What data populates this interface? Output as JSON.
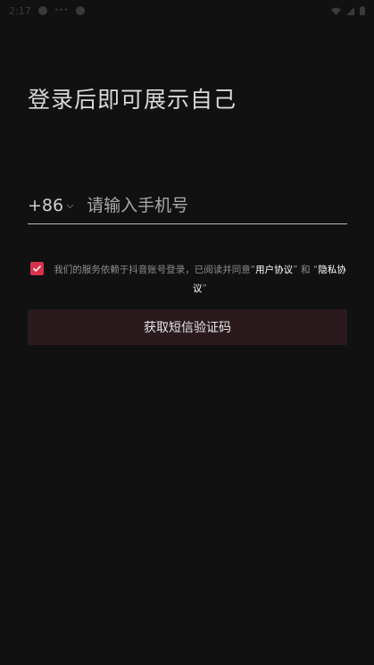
{
  "status_bar": {
    "time": "2:17",
    "small": "•••"
  },
  "login": {
    "title": "登录后即可展示自己",
    "country_code": "+86",
    "phone_placeholder": "请输入手机号",
    "agreement_prefix": "我们的服务依赖于抖音账号登录，已阅读并同意",
    "agreement_q1_open": "“",
    "user_agreement": "用户协议",
    "agreement_q1_close": "”",
    "agreement_and": " 和 ",
    "agreement_q2_open": "“",
    "privacy_agreement": "隐私协议",
    "agreement_q2_close": "”",
    "agreement_checked": true,
    "submit_label": "获取短信验证码"
  },
  "colors": {
    "background": "#111111",
    "checkbox": "#d8324b",
    "button_bg": "#2a1a1d"
  }
}
